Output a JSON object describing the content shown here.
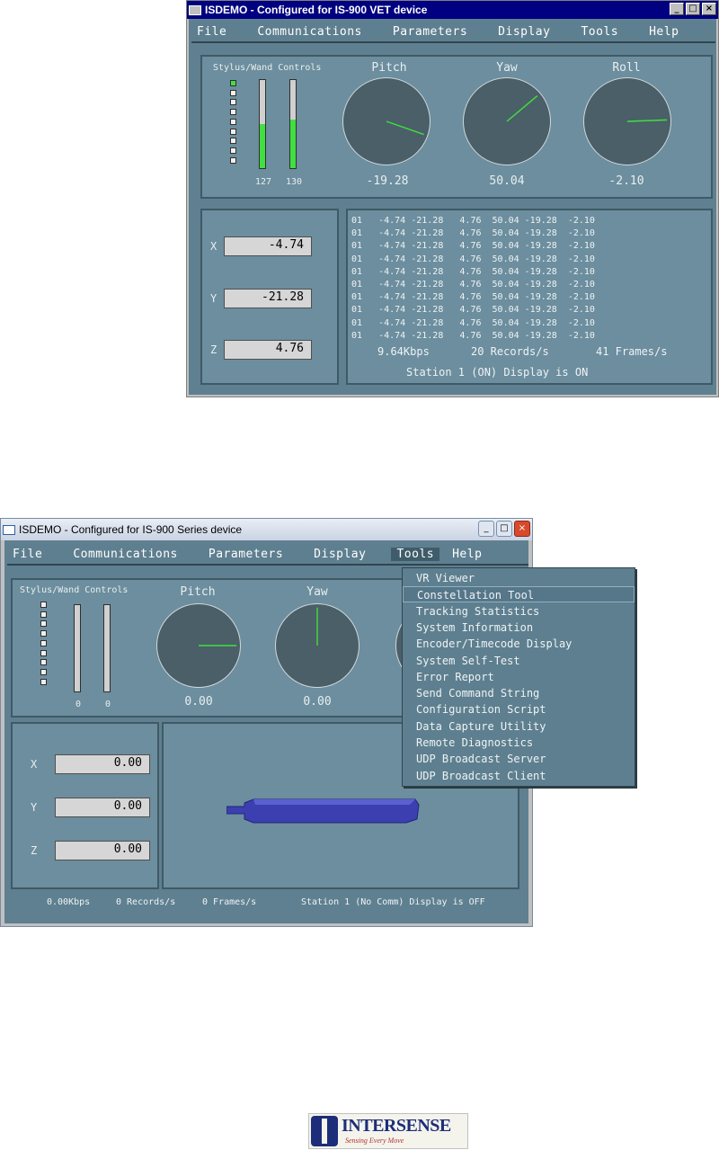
{
  "window1": {
    "title": "ISDEMO - Configured for IS-900 VET device",
    "controls": [
      "_",
      "□",
      "×"
    ],
    "menu": [
      "File",
      "Communications",
      "Parameters",
      "Display",
      "Tools",
      "Help"
    ],
    "stylus_label": "Stylus/Wand Controls",
    "led_states": [
      true,
      false,
      false,
      false,
      false,
      false,
      false,
      false,
      false
    ],
    "bars": [
      {
        "label": "127",
        "fill": 0.5
      },
      {
        "label": "130",
        "fill": 0.55
      }
    ],
    "dials": [
      {
        "title": "Pitch",
        "value": "-19.28",
        "angle_deg": -19.28
      },
      {
        "title": "Yaw",
        "value": "50.04",
        "angle_deg": 40
      },
      {
        "title": "Roll",
        "value": "-2.10",
        "angle_deg": 2.1
      }
    ],
    "xyz": [
      {
        "axis": "X",
        "value": "-4.74"
      },
      {
        "axis": "Y",
        "value": "-21.28"
      },
      {
        "axis": "Z",
        "value": "4.76"
      }
    ],
    "records": [
      "01   -4.74 -21.28   4.76  50.04 -19.28  -2.10",
      "01   -4.74 -21.28   4.76  50.04 -19.28  -2.10",
      "01   -4.74 -21.28   4.76  50.04 -19.28  -2.10",
      "01   -4.74 -21.28   4.76  50.04 -19.28  -2.10",
      "01   -4.74 -21.28   4.76  50.04 -19.28  -2.10",
      "01   -4.74 -21.28   4.76  50.04 -19.28  -2.10",
      "01   -4.74 -21.28   4.76  50.04 -19.28  -2.10",
      "01   -4.74 -21.28   4.76  50.04 -19.28  -2.10",
      "01   -4.74 -21.28   4.76  50.04 -19.28  -2.10",
      "01   -4.74 -21.28   4.76  50.04 -19.28  -2.10"
    ],
    "rate": "9.64Kbps",
    "records_per_sec": "20 Records/s",
    "frames_per_sec": "41 Frames/s",
    "station_status": "Station 1 (ON) Display is ON"
  },
  "window2": {
    "title": "ISDEMO - Configured for IS-900 Series device",
    "controls": [
      "_",
      "□",
      "×"
    ],
    "menu": [
      "File",
      "Communications",
      "Parameters",
      "Display",
      "Tools",
      "Help"
    ],
    "active_menu": "Tools",
    "stylus_label": "Stylus/Wand Controls",
    "led_states": [
      false,
      false,
      false,
      false,
      false,
      false,
      false,
      false,
      false
    ],
    "bars": [
      {
        "label": "0",
        "fill": 0
      },
      {
        "label": "0",
        "fill": 0
      }
    ],
    "dials": [
      {
        "title": "Pitch",
        "value": "0.00",
        "angle_deg": 0
      },
      {
        "title": "Yaw",
        "value": "0.00",
        "angle_deg": 90
      }
    ],
    "xyz": [
      {
        "axis": "X",
        "value": "0.00"
      },
      {
        "axis": "Y",
        "value": "0.00"
      },
      {
        "axis": "Z",
        "value": "0.00"
      }
    ],
    "tools_menu": [
      "VR Viewer",
      "Constellation Tool",
      "Tracking Statistics",
      "System Information",
      "Encoder/Timecode Display",
      "System Self-Test",
      "Error Report",
      "Send Command String",
      "Configuration Script",
      "Data Capture Utility",
      "Remote Diagnostics",
      "UDP Broadcast Server",
      "UDP Broadcast Client"
    ],
    "highlighted_item": "Constellation Tool",
    "rate": "0.00Kbps",
    "records_per_sec": "0 Records/s",
    "frames_per_sec": "0 Frames/s",
    "station_status": "Station 1 (No Comm) Display is OFF"
  },
  "logo": {
    "brand": "INTERSENSE",
    "tagline": "Sensing Every Move"
  },
  "colors": {
    "panel": "#6c8e9e",
    "led_on": "#40e040",
    "needle": "#40e040",
    "menu_text": "#ffffff"
  }
}
